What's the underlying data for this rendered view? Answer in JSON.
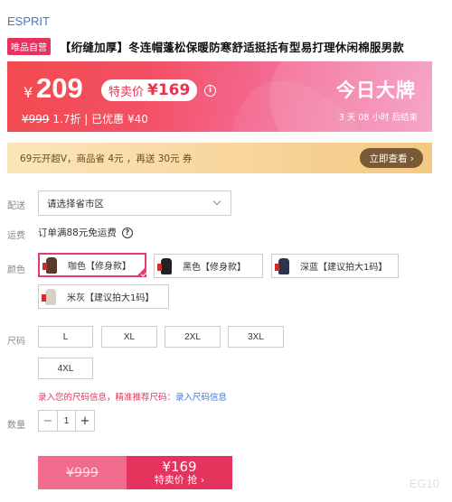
{
  "brand": "ESPRIT",
  "badge": "唯品自营",
  "title": "【绗缝加厚】冬连帽蓬松保暖防寒舒适挺括有型易打理休闲棉服男款",
  "price": {
    "currency": "¥",
    "current": "209",
    "sale_label": "特卖价",
    "sale_price": "¥169",
    "original": "¥999",
    "discount": "1.7折",
    "separator": "|",
    "coupon": "已优惠 ¥40",
    "promo_title": "今日大牌",
    "countdown": "3 天 08 小时 后结束",
    "info_icon": "i"
  },
  "vip": {
    "text": "69元开超V，商品省 4元 ，再送 30元 券",
    "button": "立即查看 ›"
  },
  "delivery": {
    "label": "配送",
    "placeholder": "请选择省市区"
  },
  "shipping": {
    "label": "运费",
    "text": "订单满88元免运费",
    "help_icon": "?"
  },
  "colors": {
    "label": "颜色",
    "options": [
      {
        "name": "咖色【修身款】",
        "swatch": "#5a3a2a",
        "selected": true
      },
      {
        "name": "黑色【修身款】",
        "swatch": "#222222",
        "selected": false
      },
      {
        "name": "深蓝【建议拍大1码】",
        "swatch": "#2a3550",
        "selected": false
      },
      {
        "name": "米灰【建议拍大1码】",
        "swatch": "#d8d2c6",
        "selected": false
      }
    ]
  },
  "sizes": {
    "label": "尺码",
    "options": [
      "L",
      "XL",
      "2XL",
      "3XL",
      "4XL"
    ],
    "hint": "录入您的尺码信息，精准推荐尺码：",
    "hint_link": "录入尺码信息"
  },
  "quantity": {
    "label": "数量",
    "value": "1",
    "minus": "−",
    "plus": "+"
  },
  "buy": {
    "original": "¥999",
    "price": "¥169",
    "action": "特卖价 抢 ›"
  },
  "watermark": "EG10"
}
